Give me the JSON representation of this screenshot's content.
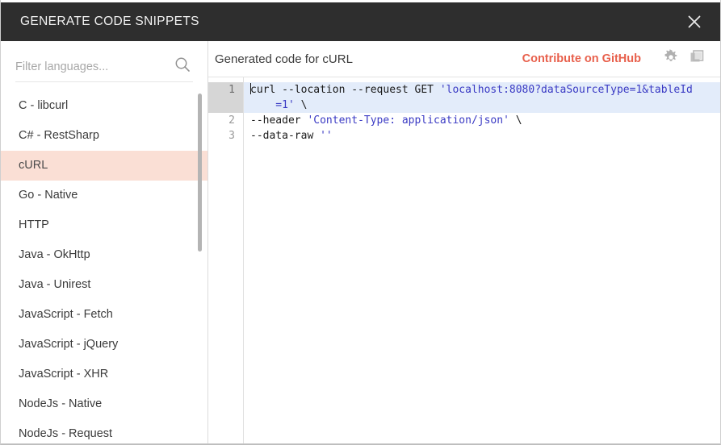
{
  "window": {
    "title": "GENERATE CODE SNIPPETS",
    "close_label": "×"
  },
  "sidebar": {
    "search": {
      "placeholder": "Filter languages...",
      "value": "",
      "icon": "search-icon"
    },
    "selected": "cURL",
    "items": [
      {
        "label": "C - libcurl"
      },
      {
        "label": "C# - RestSharp"
      },
      {
        "label": "cURL"
      },
      {
        "label": "Go - Native"
      },
      {
        "label": "HTTP"
      },
      {
        "label": "Java - OkHttp"
      },
      {
        "label": "Java - Unirest"
      },
      {
        "label": "JavaScript - Fetch"
      },
      {
        "label": "JavaScript - jQuery"
      },
      {
        "label": "JavaScript - XHR"
      },
      {
        "label": "NodeJs - Native"
      },
      {
        "label": "NodeJs - Request"
      }
    ]
  },
  "panel": {
    "title": "Generated code for cURL",
    "contribute_label": "Contribute on GitHub",
    "settings_icon": "gear-icon",
    "copy_icon": "copy-icon"
  },
  "editor": {
    "language": "cURL",
    "active_line": 1,
    "line_numbers": [
      "1",
      "2",
      "3"
    ],
    "lines": [
      {
        "number": "1",
        "active": true,
        "segments": [
          {
            "type": "plain",
            "text": "curl "
          },
          {
            "type": "plain",
            "text": "--location --request GET "
          },
          {
            "type": "string",
            "text": "'localhost:8080?dataSourceType=1&tableId"
          }
        ]
      },
      {
        "number": "",
        "active": true,
        "continuation": true,
        "segments": [
          {
            "type": "string",
            "text": "    =1'"
          },
          {
            "type": "plain",
            "text": " \\"
          }
        ]
      },
      {
        "number": "2",
        "active": false,
        "segments": [
          {
            "type": "plain",
            "text": "--header "
          },
          {
            "type": "string",
            "text": "'Content-Type: application/json'"
          },
          {
            "type": "plain",
            "text": " \\"
          }
        ]
      },
      {
        "number": "3",
        "active": false,
        "segments": [
          {
            "type": "plain",
            "text": "--data-raw "
          },
          {
            "type": "string",
            "text": "''"
          }
        ]
      }
    ],
    "full_text": "curl --location --request GET 'localhost:8080?dataSourceType=1&tableId=1' \\\n--header 'Content-Type: application/json' \\\n--data-raw ''"
  },
  "colors": {
    "titlebar_bg": "#2e2e2e",
    "accent": "#e8604c",
    "selection_bg": "#fadfd5",
    "active_line_bg": "#e3ecfa",
    "string_token": "#3a3ac4"
  }
}
